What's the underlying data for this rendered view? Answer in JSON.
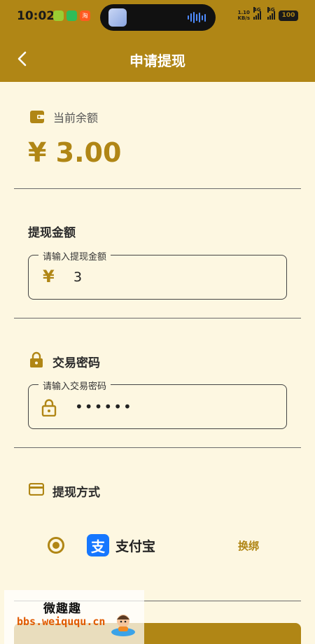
{
  "status_bar": {
    "time": "10:02",
    "net_speed_value": "1.10",
    "net_speed_unit": "KB/s",
    "signal_1_label": "4G",
    "signal_2_label": "4G",
    "battery": "100",
    "app_3_label": "淘"
  },
  "header": {
    "title": "申请提现",
    "back_icon": "chevron-left-icon"
  },
  "balance": {
    "label": "当前余额",
    "value": "¥ 3.00",
    "icon": "wallet-icon"
  },
  "amount": {
    "section_title": "提现金额",
    "legend": "请输入提现金额",
    "prefix": "¥",
    "value": "3"
  },
  "password": {
    "section_title": "交易密码",
    "legend": "请输入交易密码",
    "masked_value": "••••••",
    "icon": "lock-icon"
  },
  "method": {
    "section_title": "提现方式",
    "icon": "card-icon",
    "option_label": "支付宝",
    "option_icon_glyph": "支",
    "selected": true,
    "rebind_label": "换绑"
  },
  "watermark": {
    "title": "微趣趣",
    "url": "bbs.weiququ.cn"
  },
  "colors": {
    "accent": "#B08615",
    "background": "#FDF7E1",
    "alipay": "#1677FF"
  }
}
